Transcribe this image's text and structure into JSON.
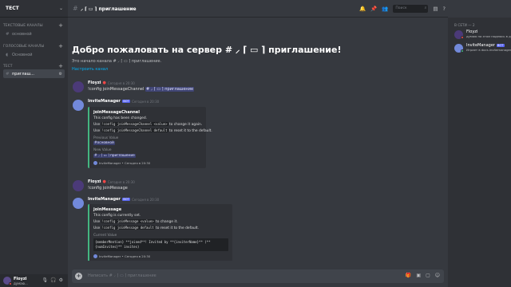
{
  "server": {
    "name": "ТЕСТ"
  },
  "categories": {
    "text": "ТЕКСТОВЫЕ КАНАЛЫ",
    "voice": "ГОЛОСОВЫЕ КАНАЛЫ",
    "test": "ТЕСТ"
  },
  "channels": {
    "main_text": "основной",
    "main_voice": "Основной",
    "invite": "приглаш..."
  },
  "topbar": {
    "channel": "⸝ ⌈ ▭ ⌉ приглашение",
    "search_placeholder": "Поиск"
  },
  "welcome": {
    "title": "Добро пожаловать на сервер # ⸝ ⌈ ▭ ⌉ приглашение!",
    "subtitle": "Это начало канала # ⸝ ⌈ ▭ ⌉ приглашение.",
    "edit_link": "Настроить канал"
  },
  "messages": {
    "m1": {
      "author": "Floyzi",
      "time": "Сегодня в 20:30",
      "text": "!config joinMessageChannel",
      "mention": "# ⸝ ⌈ ▭ ⌉ приглашение"
    },
    "m2": {
      "author": "InviteManager",
      "badge": "BOT",
      "time": "Сегодня в 20:30",
      "embed": {
        "title": "joinMessageChannel",
        "line1": "This config has been changed.",
        "line2_a": "Use ",
        "line2_code": "!config joinMessageChannel <value>",
        "line2_b": " to change it again.",
        "line3_a": "Use ",
        "line3_code": "!config joinMessageChannel default",
        "line3_b": " to reset it to the default.",
        "prev_label": "Previous Value",
        "prev_value": "#основной",
        "new_label": "New Value",
        "new_value": "# ⸝ ⌈ ▭ ⌉ приглашение",
        "footer": "InviteManager • Сегодня в 20:30"
      }
    },
    "m3": {
      "author": "Floyzi",
      "time": "Сегодня в 20:30",
      "text": "!config joinMessage"
    },
    "m4": {
      "author": "InviteManager",
      "badge": "BOT",
      "time": "Сегодня в 20:30",
      "embed": {
        "title": "joinMessage",
        "line1": "This config is currently set.",
        "line2_a": "Use ",
        "line2_code": "!config joinMessage <value>",
        "line2_b": " to change it.",
        "line3_a": "Use ",
        "line3_code": "!config joinMessage default",
        "line3_b": " to reset it to the default.",
        "cur_label": "Current Value",
        "cur_value": "{memberMention} **joined**! Invited by **{inviterName}** (**{numInvites}** invites)",
        "footer": "InviteManager • Сегодня в 20:30"
      }
    }
  },
  "composer": {
    "placeholder": "Написать # ⸝ ⌈ ▭ ⌉ приглашение"
  },
  "members": {
    "section": "В СЕТИ — 2",
    "list": [
      {
        "name": "Floyzi",
        "activity": "думаю на этом надеюсь в дальнейшем",
        "status_color": "#f04747"
      },
      {
        "name": "InviteManager",
        "badge": "BOT",
        "activity": "Играет в docs.invitemanager.gg",
        "status_color": "#43b581"
      }
    ]
  },
  "user": {
    "name": "Floyzi",
    "tag": "думаю..."
  },
  "colors": {
    "accent": "#5865f2",
    "online": "#43b581",
    "dnd": "#f04747",
    "embed_bar": "#43b581",
    "link": "#00b0f4"
  }
}
